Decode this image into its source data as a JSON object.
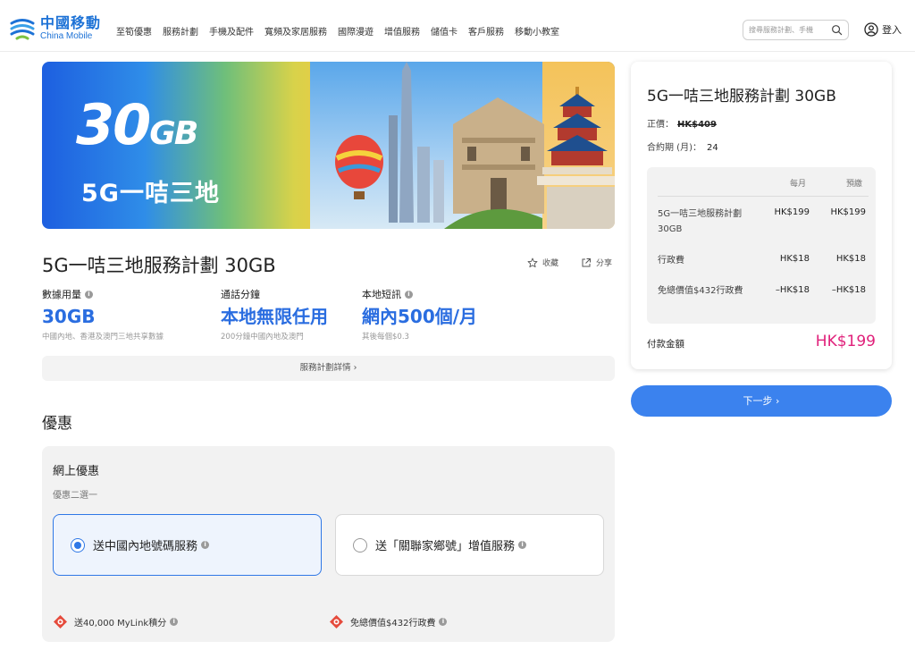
{
  "brand": {
    "name_cn": "中國移動",
    "name_en": "China Mobile"
  },
  "nav": {
    "items": [
      "至筍優惠",
      "服務計劃",
      "手機及配件",
      "寬頻及家居服務",
      "國際漫遊",
      "增值服務",
      "儲值卡",
      "客戶服務",
      "移動小教室"
    ]
  },
  "search": {
    "placeholder": "搜尋服務計劃、手機"
  },
  "login": {
    "label": "登入"
  },
  "banner": {
    "big": "30",
    "unit": "GB",
    "subtitle": "5G一咭三地"
  },
  "plan": {
    "title": "5G一咭三地服務計劃 30GB",
    "favorite_label": "收藏",
    "share_label": "分享",
    "specs": [
      {
        "label": "數據用量",
        "value": "30GB",
        "note": "中國內地、香港及澳門三地共享數據"
      },
      {
        "label": "通話分鐘",
        "value": "本地無限任用",
        "note": "200分鐘中國內地及澳門"
      },
      {
        "label": "本地短訊",
        "value": "網內500個/月",
        "note": "其後每個$0.3"
      }
    ],
    "details_label": "服務計劃詳情 ›"
  },
  "offers": {
    "section_title": "優惠",
    "online_title": "網上優惠",
    "choose_hint": "優惠二選一",
    "options": [
      {
        "label": "送中國內地號碼服務",
        "selected": true
      },
      {
        "label": "送「關聯家鄉號」增值服務",
        "selected": false
      }
    ],
    "perks": [
      {
        "label": "送40,000 MyLink積分"
      },
      {
        "label": "免總價值$432行政費"
      }
    ]
  },
  "summary": {
    "title": "5G一咭三地服務計劃 30GB",
    "original_price_label": "正價：",
    "original_price": "HK$409",
    "contract_label": "合約期 (月)：",
    "contract_value": "24",
    "col_monthly": "每月",
    "col_prepaid": "預繳",
    "rows": [
      {
        "label": "5G一咭三地服務計劃 30GB",
        "monthly": "HK$199",
        "prepaid": "HK$199"
      },
      {
        "label": "行政費",
        "monthly": "HK$18",
        "prepaid": "HK$18"
      },
      {
        "label": "免總價值$432行政費",
        "monthly": "–HK$18",
        "prepaid": "–HK$18"
      }
    ],
    "pay_label": "付款金額",
    "pay_value": "HK$199"
  },
  "next_button": {
    "label": "下一步 ›"
  },
  "colors": {
    "brand_blue": "#1d72d6",
    "accent_blue": "#3b82ee",
    "price_pink": "#e0207a"
  }
}
